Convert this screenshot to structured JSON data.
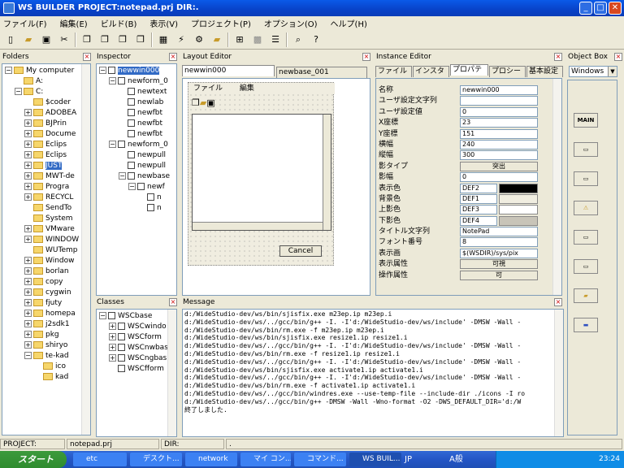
{
  "window": {
    "title": "WS BUILDER PROJECT:notepad.prj DIR:.",
    "min": "_",
    "max": "□",
    "close": "✕"
  },
  "menu": [
    "ファイル(F)",
    "編集(E)",
    "ビルド(B)",
    "表示(V)",
    "プロジェクト(P)",
    "オプション(O)",
    "ヘルプ(H)"
  ],
  "folders": {
    "title": "Folders",
    "items": [
      {
        "label": "My computer",
        "level": 0,
        "exp": "−"
      },
      {
        "label": "A:",
        "level": 1,
        "exp": ""
      },
      {
        "label": "C:",
        "level": 1,
        "exp": "−"
      },
      {
        "label": "$coder",
        "level": 2,
        "exp": ""
      },
      {
        "label": "ADOBEA",
        "level": 2,
        "exp": "+"
      },
      {
        "label": "BJPrin",
        "level": 2,
        "exp": "+"
      },
      {
        "label": "Docume",
        "level": 2,
        "exp": "+"
      },
      {
        "label": "Eclips",
        "level": 2,
        "exp": "+"
      },
      {
        "label": "Eclips",
        "level": 2,
        "exp": "+"
      },
      {
        "label": "JUST",
        "level": 2,
        "exp": "+",
        "selected": true
      },
      {
        "label": "MWT-de",
        "level": 2,
        "exp": "+"
      },
      {
        "label": "Progra",
        "level": 2,
        "exp": "+"
      },
      {
        "label": "RECYCL",
        "level": 2,
        "exp": "+"
      },
      {
        "label": "SendTo",
        "level": 2,
        "exp": ""
      },
      {
        "label": "System",
        "level": 2,
        "exp": ""
      },
      {
        "label": "VMware",
        "level": 2,
        "exp": "+"
      },
      {
        "label": "WINDOW",
        "level": 2,
        "exp": "+"
      },
      {
        "label": "WUTemp",
        "level": 2,
        "exp": ""
      },
      {
        "label": "Window",
        "level": 2,
        "exp": "+"
      },
      {
        "label": "borlan",
        "level": 2,
        "exp": "+"
      },
      {
        "label": "copy",
        "level": 2,
        "exp": "+"
      },
      {
        "label": "cygwin",
        "level": 2,
        "exp": "+"
      },
      {
        "label": "fjuty",
        "level": 2,
        "exp": "+"
      },
      {
        "label": "homepa",
        "level": 2,
        "exp": "+"
      },
      {
        "label": "j2sdk1",
        "level": 2,
        "exp": "+"
      },
      {
        "label": "pkg",
        "level": 2,
        "exp": "+"
      },
      {
        "label": "shiryo",
        "level": 2,
        "exp": "+"
      },
      {
        "label": "te-kad",
        "level": 2,
        "exp": "−"
      },
      {
        "label": "ico",
        "level": 3,
        "exp": ""
      },
      {
        "label": "kad",
        "level": 3,
        "exp": ""
      }
    ]
  },
  "inspector": {
    "title": "Inspector",
    "items": [
      {
        "label": "newwin000",
        "level": 0,
        "exp": "−",
        "selected": true
      },
      {
        "label": "newform_0",
        "level": 1,
        "exp": "−"
      },
      {
        "label": "newtext",
        "level": 2,
        "exp": ""
      },
      {
        "label": "newlab",
        "level": 2,
        "exp": ""
      },
      {
        "label": "newfbt",
        "level": 2,
        "exp": ""
      },
      {
        "label": "newfbt",
        "level": 2,
        "exp": ""
      },
      {
        "label": "newfbt",
        "level": 2,
        "exp": ""
      },
      {
        "label": "newform_0",
        "level": 1,
        "exp": "−"
      },
      {
        "label": "newpull",
        "level": 2,
        "exp": ""
      },
      {
        "label": "newpull",
        "level": 2,
        "exp": ""
      },
      {
        "label": "newbase",
        "level": 2,
        "exp": "−"
      },
      {
        "label": "newf",
        "level": 3,
        "exp": "−"
      },
      {
        "label": "n",
        "level": 4,
        "exp": ""
      },
      {
        "label": "n",
        "level": 4,
        "exp": ""
      }
    ]
  },
  "classes": {
    "title": "Classes",
    "items": [
      {
        "label": "WSCbase",
        "level": 0,
        "exp": "−"
      },
      {
        "label": "WSCwindo",
        "level": 1,
        "exp": "+"
      },
      {
        "label": "WSCform",
        "level": 1,
        "exp": "+"
      },
      {
        "label": "WSCnwbas",
        "level": 1,
        "exp": "+"
      },
      {
        "label": "WSCngbas",
        "level": 1,
        "exp": "+"
      },
      {
        "label": "WSCfform",
        "level": 1,
        "exp": ""
      }
    ]
  },
  "layout": {
    "title": "Layout Editor",
    "tab1": "newwin000",
    "tab2": "newbase_001",
    "form_menu1": "ファイル",
    "form_menu2": "編集",
    "cancel": "Cancel"
  },
  "instance": {
    "title": "Instance Editor",
    "tabs": [
      "ファイル",
      "インスタ",
      "プロパテ",
      "プロシー",
      "基本設定"
    ],
    "props": [
      {
        "name": "名称",
        "value": "newwin000"
      },
      {
        "name": "ユーザ設定文字列",
        "value": ""
      },
      {
        "name": "ユーザ設定値",
        "value": "0"
      },
      {
        "name": "X座標",
        "value": "23"
      },
      {
        "name": "Y座標",
        "value": "151"
      },
      {
        "name": "横幅",
        "value": "240"
      },
      {
        "name": "縦幅",
        "value": "300"
      },
      {
        "name": "影タイプ",
        "drop": "突出"
      },
      {
        "name": "影幅",
        "value": "0"
      },
      {
        "name": "表示色",
        "value": "DEF2",
        "swatch": "#000000"
      },
      {
        "name": "背景色",
        "value": "DEF1",
        "swatch": "#f0ede0"
      },
      {
        "name": "上影色",
        "value": "DEF3",
        "swatch": "#ffffff"
      },
      {
        "name": "下影色",
        "value": "DEF4",
        "swatch": "#c8c4b8"
      },
      {
        "name": "タイトル文字列",
        "value": "NotePad"
      },
      {
        "name": "フォント番号",
        "value": "8"
      },
      {
        "name": "表示画",
        "value": "$(WSDIR)/sys/pix"
      },
      {
        "name": "表示属性",
        "drop": "可視"
      },
      {
        "name": "操作属性",
        "drop": "可"
      }
    ]
  },
  "objectbox": {
    "title": "Object Box",
    "select": "Windows",
    "main": "MAIN"
  },
  "message": {
    "title": "Message",
    "lines": [
      "d:/WideStudio-dev/ws/bin/sjisfix.exe m23ep.ip  m23ep.i",
      "d:/WideStudio-dev/ws/../gcc/bin/g++ -I. -I'd:/WideStudio-dev/ws/include'  -DMSW -Wall -",
      "d:/WideStudio-dev/ws/bin/rm.exe -f m23ep.ip m23ep.i",
      "d:/WideStudio-dev/ws/bin/sjisfix.exe resize1.ip  resize1.i",
      "d:/WideStudio-dev/ws/../gcc/bin/g++ -I. -I'd:/WideStudio-dev/ws/include'  -DMSW -Wall -",
      "d:/WideStudio-dev/ws/bin/rm.exe -f resize1.ip resize1.i",
      "d:/WideStudio-dev/ws/../gcc/bin/g++ -I. -I'd:/WideStudio-dev/ws/include'  -DMSW -Wall -",
      "d:/WideStudio-dev/ws/bin/sjisfix.exe activate1.ip  activate1.i",
      "d:/WideStudio-dev/ws/../gcc/bin/g++ -I. -I'd:/WideStudio-dev/ws/include'  -DMSW -Wall -",
      "d:/WideStudio-dev/ws/bin/rm.exe -f activate1.ip activate1.i",
      "d:/WideStudio-dev/ws/../gcc/bin/windres.exe --use-temp-file --include-dir ./icons -I ro",
      "d:/WideStudio-dev/ws/../gcc/bin/g++ -DMSW -Wall -Wno-format -O2  -DWS_DEFAULT_DIR='d:/W",
      "終了しました."
    ]
  },
  "status": {
    "project_label": "PROJECT:",
    "project_value": "notepad.prj",
    "dir_label": "DIR:",
    "dir_value": "."
  },
  "taskbar": {
    "start": "スタート",
    "tasks": [
      "etc",
      "デスクト...",
      "network",
      "マイ コン...",
      "コマンド...",
      "WS BUIL..."
    ],
    "lang": "JP",
    "ime": "A般",
    "clock": "23:24"
  }
}
